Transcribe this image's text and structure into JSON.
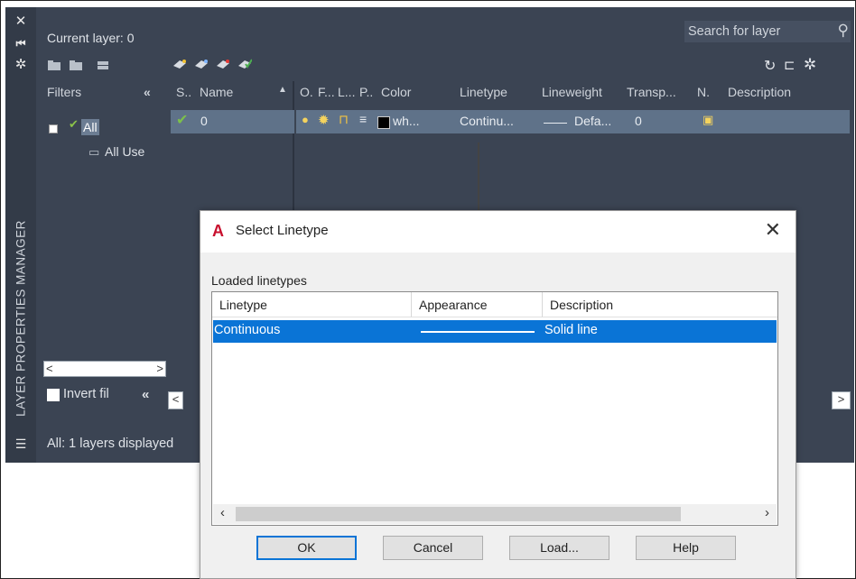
{
  "palette": {
    "vertical_title": "LAYER PROPERTIES MANAGER",
    "current_layer": "Current layer: 0",
    "search_placeholder": "Search for layer",
    "filters_header": "Filters",
    "filters_collapse": "«",
    "tree_all": "All",
    "tree_all_used": "All Use",
    "invert_filter": "Invert fil",
    "invert_collapse": "«",
    "status_text": "All: 1 layers displayed",
    "columns": [
      "S..",
      "Name",
      "O.",
      "F...",
      "L...",
      "P..",
      "Color",
      "Linetype",
      "Lineweight",
      "Transp...",
      "N.",
      "Description"
    ],
    "layer_row": {
      "name": "0",
      "color": "wh...",
      "linetype": "Continu...",
      "lineweight": "Defa...",
      "transparency": "0"
    }
  },
  "dialog": {
    "title": "Select Linetype",
    "logo": "A",
    "loaded_label": "Loaded linetypes",
    "headers": [
      "Linetype",
      "Appearance",
      "Description"
    ],
    "rows": [
      {
        "linetype": "Continuous",
        "description": "Solid line"
      }
    ],
    "buttons": {
      "ok": "OK",
      "cancel": "Cancel",
      "load": "Load...",
      "help": "Help"
    }
  },
  "colors": {
    "palette_bg": "#3b4453",
    "selected_row": "#5f7289",
    "dialog_selection": "#0a74d6",
    "autocad_red": "#c8102e"
  }
}
